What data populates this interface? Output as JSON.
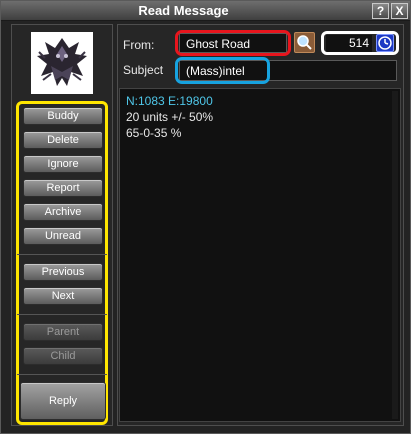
{
  "window": {
    "title": "Read Message",
    "help": "?",
    "close": "X"
  },
  "sidebar": {
    "buttons": [
      {
        "label": "Buddy"
      },
      {
        "label": "Delete"
      },
      {
        "label": "Ignore"
      },
      {
        "label": "Report"
      },
      {
        "label": "Archive"
      },
      {
        "label": "Unread"
      },
      {
        "label": "Previous"
      },
      {
        "label": "Next"
      },
      {
        "label": "Parent"
      },
      {
        "label": "Child"
      },
      {
        "label": "Reply"
      }
    ]
  },
  "message": {
    "from_label": "From:",
    "from_value": "Ghost Road",
    "number": "514",
    "subject_label": "Subject",
    "subject_value": "(Mass)intel",
    "body_lines": [
      "N:1083 E:19800",
      "20 units +/- 50%",
      "65-0-35  %"
    ]
  },
  "icons": {
    "search": "search-icon",
    "clock": "clock-icon",
    "avatar": "character-portrait"
  },
  "colors": {
    "highlight_yellow": "#ffe600",
    "highlight_red": "#e8151d",
    "highlight_blue": "#17a3e0",
    "coord_text": "#4fc6e8"
  }
}
